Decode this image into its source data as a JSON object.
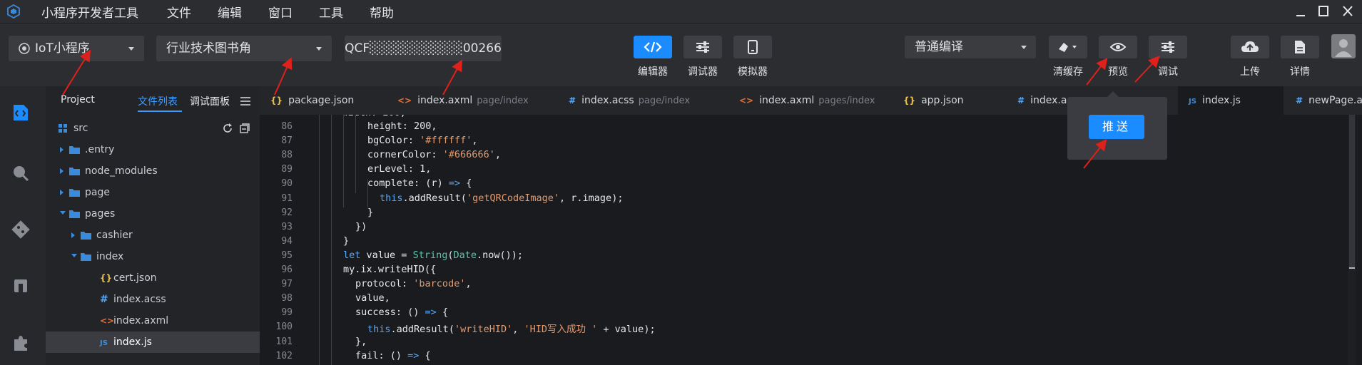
{
  "app": {
    "title": "小程序开发者工具"
  },
  "menu": [
    "文件",
    "编辑",
    "窗口",
    "工具",
    "帮助"
  ],
  "toolbar": {
    "project_type": "IoT小程序",
    "project_name": "行业技术图书角",
    "appid": "QCF░░░░░░░░░░00266",
    "editor_label": "编辑器",
    "debugger_label": "调试器",
    "simulator_label": "模拟器",
    "compile_mode": "普通编译",
    "clear_cache_label": "清缓存",
    "preview_label": "预览",
    "debug_label": "调试",
    "upload_label": "上传",
    "details_label": "详情"
  },
  "popup": {
    "push_label": "推送"
  },
  "sidebar_tabs": {
    "project": "Project",
    "files": "文件列表",
    "debug_panel": "调试面板"
  },
  "tree": {
    "root": "src",
    "items": [
      {
        "label": ".entry",
        "type": "folder",
        "depth": 0,
        "open": false
      },
      {
        "label": "node_modules",
        "type": "folder",
        "depth": 0,
        "open": false
      },
      {
        "label": "page",
        "type": "folder",
        "depth": 0,
        "open": false
      },
      {
        "label": "pages",
        "type": "folder",
        "depth": 0,
        "open": true
      },
      {
        "label": "cashier",
        "type": "folder",
        "depth": 1,
        "open": false
      },
      {
        "label": "index",
        "type": "folder",
        "depth": 1,
        "open": true
      },
      {
        "label": "cert.json",
        "type": "json",
        "depth": 2
      },
      {
        "label": "index.acss",
        "type": "acss",
        "depth": 2
      },
      {
        "label": "index.axml",
        "type": "axml",
        "depth": 2
      },
      {
        "label": "index.js",
        "type": "js",
        "depth": 2,
        "selected": true
      }
    ]
  },
  "tabs": [
    {
      "name": "package.json",
      "path": "",
      "icon": "json"
    },
    {
      "name": "index.axml",
      "path": "page/index",
      "icon": "axml"
    },
    {
      "name": "index.acss",
      "path": "page/index",
      "icon": "acss"
    },
    {
      "name": "index.axml",
      "path": "pages/index",
      "icon": "axml"
    },
    {
      "name": "app.json",
      "path": "",
      "icon": "json"
    },
    {
      "name": "index.a",
      "path": "",
      "icon": "acss"
    },
    {
      "name": "index.js",
      "path": "",
      "icon": "js",
      "active": true
    },
    {
      "name": "newPage.a",
      "path": "",
      "icon": "acss"
    }
  ],
  "code_lines": [
    {
      "n": "86",
      "indent": 4,
      "html": "<span class='prop'>height</span>: 200,"
    },
    {
      "n": "87",
      "indent": 4,
      "html": "<span class='prop'>bgColor</span>: <span class='str'>'#ffffff'</span>,"
    },
    {
      "n": "88",
      "indent": 4,
      "html": "<span class='prop'>cornerColor</span>: <span class='str'>'#666666'</span>,"
    },
    {
      "n": "89",
      "indent": 4,
      "html": "<span class='prop'>erLevel</span>: 1,"
    },
    {
      "n": "90",
      "indent": 4,
      "html": "<span class='prop'>complete</span>: (<span class='prop'>r</span>) <span class='kw'>=&gt;</span> {"
    },
    {
      "n": "91",
      "indent": 5,
      "html": "<span class='kw'>this</span>.<span class='fn'>addResult</span>(<span class='str'>'getQRCodeImage'</span>, <span class='prop'>r</span>.<span class='prop'>image</span>);"
    },
    {
      "n": "92",
      "indent": 4,
      "html": "}"
    },
    {
      "n": "93",
      "indent": 3,
      "html": "})"
    },
    {
      "n": "94",
      "indent": 2,
      "html": "}"
    },
    {
      "n": "95",
      "indent": 2,
      "html": "<span class='kw'>let</span> <span class='prop'>value</span> = <span class='cls'>String</span>(<span class='cls'>Date</span>.<span class='fn'>now</span>());"
    },
    {
      "n": "96",
      "indent": 2,
      "html": "<span class='prop'>my</span>.<span class='prop'>ix</span>.<span class='fn'>writeHID</span>({"
    },
    {
      "n": "97",
      "indent": 3,
      "html": "<span class='prop'>protocol</span>: <span class='str'>'barcode'</span>,"
    },
    {
      "n": "98",
      "indent": 3,
      "html": "<span class='prop'>value</span>,"
    },
    {
      "n": "99",
      "indent": 3,
      "html": "<span class='prop'>success</span>: () <span class='kw'>=&gt;</span> {"
    },
    {
      "n": "100",
      "indent": 4,
      "html": "<span class='kw'>this</span>.<span class='fn'>addResult</span>(<span class='str'>'writeHID'</span>, <span class='str'>'HID写入成功 '</span> + <span class='prop'>value</span>);"
    },
    {
      "n": "101",
      "indent": 3,
      "html": "},"
    },
    {
      "n": "102",
      "indent": 3,
      "html": "<span class='prop'>fail</span>: () <span class='kw'>=&gt;</span> {"
    }
  ],
  "colors": {
    "accent": "#1a8cff",
    "annotation": "#e0201b",
    "background": "#1e1f22"
  }
}
